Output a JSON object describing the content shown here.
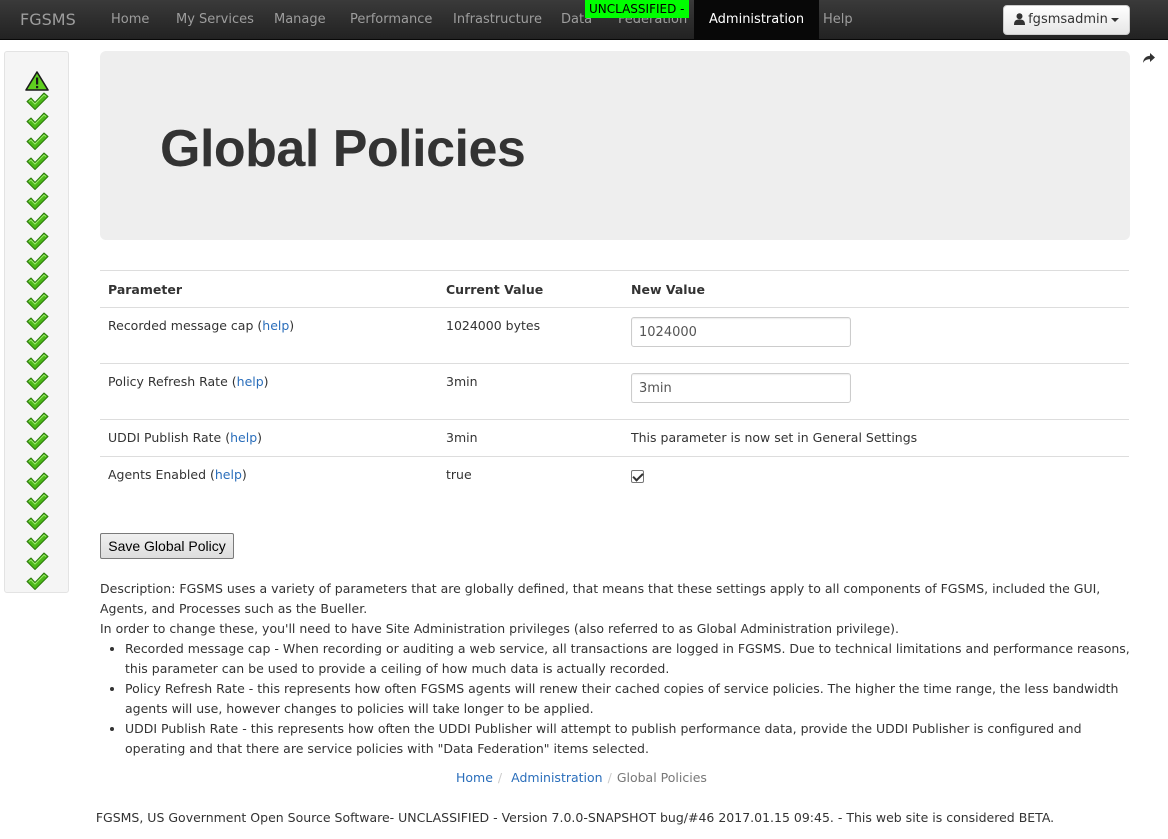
{
  "navbar": {
    "brand": "FGSMS",
    "items": [
      {
        "label": "Home"
      },
      {
        "label": "My Services"
      },
      {
        "label": "Manage"
      },
      {
        "label": "Performance"
      },
      {
        "label": "Infrastructure"
      },
      {
        "label": "Data"
      },
      {
        "label": "Federation"
      },
      {
        "label": "Administration"
      },
      {
        "label": "Help"
      }
    ],
    "active_item": "Administration",
    "classification": "UNCLASSIFIED -",
    "classification_color": "#00ff00",
    "user": "fgsmsadmin"
  },
  "status_panel": {
    "icons": [
      "warning-icon",
      "check-icon",
      "check-icon",
      "check-icon",
      "check-icon",
      "check-icon",
      "check-icon",
      "check-icon",
      "check-icon",
      "check-icon",
      "check-icon",
      "check-icon",
      "check-icon",
      "check-icon",
      "check-icon",
      "check-icon",
      "check-icon",
      "check-icon",
      "check-icon",
      "check-icon",
      "check-icon",
      "check-icon",
      "check-icon",
      "check-icon",
      "check-icon",
      "check-icon"
    ]
  },
  "page": {
    "title": "Global Policies"
  },
  "table": {
    "headers": [
      "Parameter",
      "Current Value",
      "New Value"
    ],
    "help_label": "help",
    "rows": [
      {
        "parameter": "Recorded message cap",
        "current": "1024000 bytes",
        "new_value": "1024000"
      },
      {
        "parameter": "Policy Refresh Rate",
        "current": "3min",
        "new_value": "3min"
      },
      {
        "parameter": "UDDI Publish Rate",
        "current": "3min",
        "new_text": "This parameter is now set in General Settings"
      },
      {
        "parameter": "Agents Enabled",
        "current": "true",
        "checked": true
      }
    ]
  },
  "save_button": "Save Global Policy",
  "description": {
    "line1": "Description: FGSMS uses a variety of parameters that are globally defined, that means that these settings apply to all components of FGSMS, included the GUI, Agents, and Processes such as the Bueller.",
    "line2": "In order to change these, you'll need to have Site Administration privileges (also referred to as Global Administration privilege).",
    "bullets": [
      "Recorded message cap - When recording or auditing a web service, all transactions are logged in FGSMS. Due to technical limitations and performance reasons, this parameter can be used to provide a ceiling of how much data is actually recorded.",
      "Policy Refresh Rate - this represents how often FGSMS agents will renew their cached copies of service policies. The higher the time range, the less bandwidth agents will use, however changes to policies will take longer to be applied.",
      "UDDI Publish Rate - this represents how often the UDDI Publisher will attempt to publish performance data, provide the UDDI Publisher is configured and operating and that there are service policies with \"Data Federation\" items selected."
    ]
  },
  "breadcrumb": {
    "items": [
      "Home",
      "Administration",
      "Global Policies"
    ],
    "separator": "/"
  },
  "footer": "FGSMS, US Government Open Source Software- UNCLASSIFIED - Version 7.0.0-SNAPSHOT bug/#46 2017.01.15 09:45. - This web site is considered BETA."
}
